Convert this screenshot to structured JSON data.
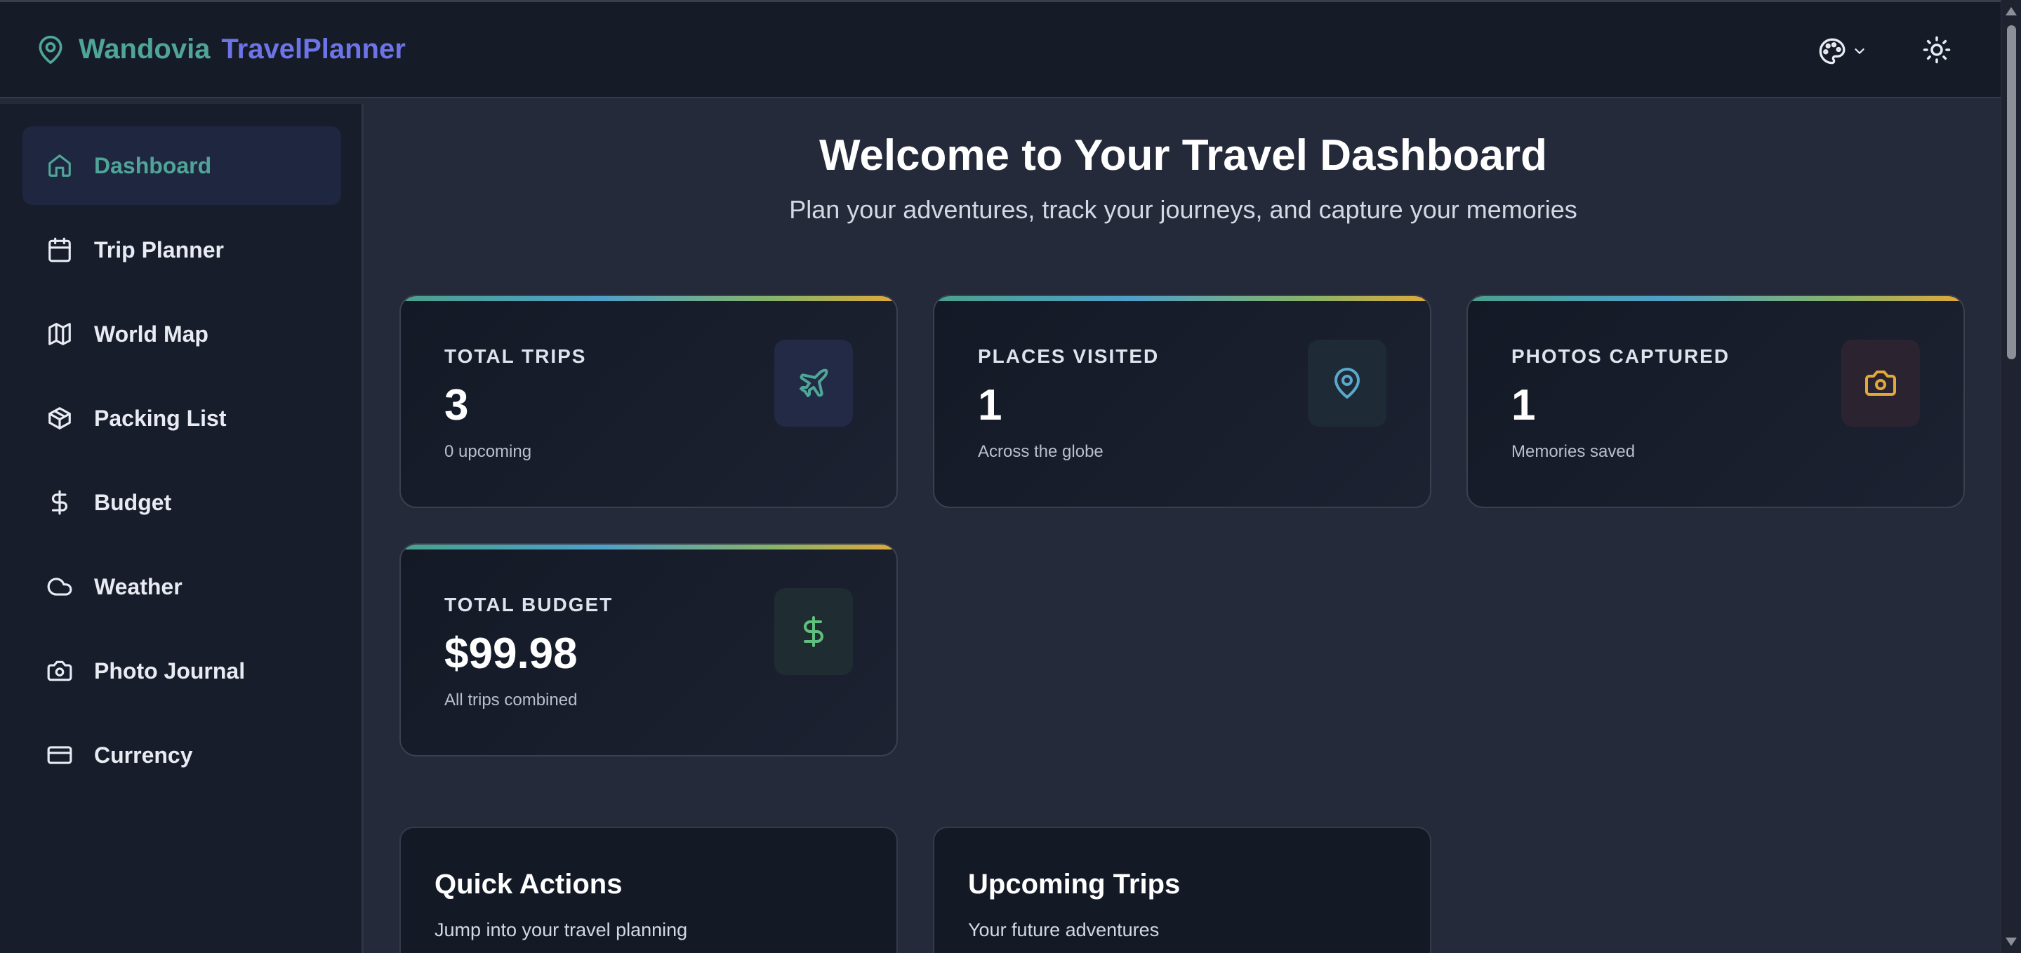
{
  "header": {
    "brand_first": "Wandovia",
    "brand_second": "TravelPlanner",
    "icons": [
      "map-pin-icon",
      "palette-icon",
      "chevron-down-icon",
      "sun-icon"
    ]
  },
  "sidebar": {
    "items": [
      {
        "label": "Dashboard",
        "icon": "home-icon",
        "active": true
      },
      {
        "label": "Trip Planner",
        "icon": "calendar-icon"
      },
      {
        "label": "World Map",
        "icon": "map-icon"
      },
      {
        "label": "Packing List",
        "icon": "package-icon"
      },
      {
        "label": "Budget",
        "icon": "dollar-icon"
      },
      {
        "label": "Weather",
        "icon": "cloud-icon"
      },
      {
        "label": "Photo Journal",
        "icon": "camera-icon"
      },
      {
        "label": "Currency",
        "icon": "credit-card-icon"
      }
    ]
  },
  "main": {
    "title": "Welcome to Your Travel Dashboard",
    "subtitle": "Plan your adventures, track your journeys, and capture your memories",
    "stats": [
      {
        "label": "TOTAL TRIPS",
        "value": "3",
        "note": "0 upcoming",
        "icon": "plane-icon",
        "color": "#4fa597"
      },
      {
        "label": "PLACES VISITED",
        "value": "1",
        "note": "Across the globe",
        "icon": "map-pin-icon",
        "color": "#5aa8cc"
      },
      {
        "label": "PHOTOS CAPTURED",
        "value": "1",
        "note": "Memories saved",
        "icon": "camera-icon",
        "color": "#e0a93a"
      },
      {
        "label": "TOTAL BUDGET",
        "value": "$99.98",
        "note": "All trips combined",
        "icon": "dollar-icon",
        "color": "#5fbf7e"
      }
    ],
    "panels": [
      {
        "title": "Quick Actions",
        "subtitle": "Jump into your travel planning"
      },
      {
        "title": "Upcoming Trips",
        "subtitle": "Your future adventures"
      }
    ]
  },
  "colors": {
    "accent_teal": "#4fa597",
    "accent_indigo": "#6d74e8",
    "background": "#242a3a",
    "sidebar": "#181d2b"
  }
}
